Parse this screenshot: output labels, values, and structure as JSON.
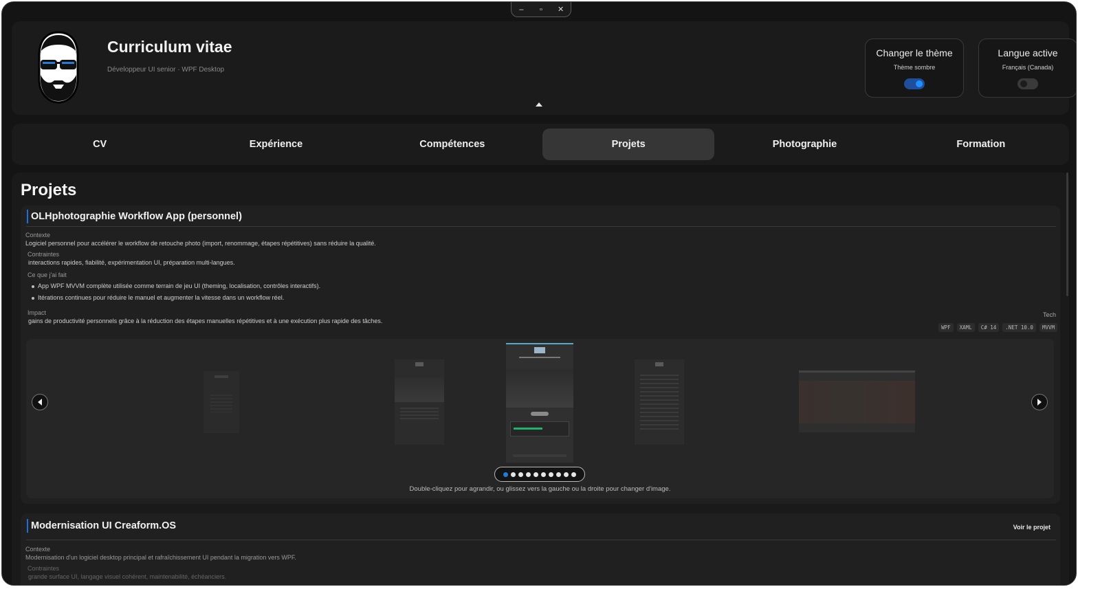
{
  "window": {
    "controls": {
      "minimize": "–",
      "maximize": "▫",
      "close": "✕"
    }
  },
  "header": {
    "title": "Curriculum vitae",
    "subtitle": "Développeur UI senior · WPF Desktop",
    "theme_card": {
      "title": "Changer le thème",
      "value": "Thème sombre",
      "toggle_on": true,
      "accent": "#1e90ff"
    },
    "language_card": {
      "title": "Langue active",
      "value": "Français (Canada)",
      "toggle_on": false
    }
  },
  "tabs": [
    {
      "label": "CV",
      "active": false
    },
    {
      "label": "Expérience",
      "active": false
    },
    {
      "label": "Compétences",
      "active": false
    },
    {
      "label": "Projets",
      "active": true
    },
    {
      "label": "Photographie",
      "active": false
    },
    {
      "label": "Formation",
      "active": false
    }
  ],
  "page": {
    "heading": "Projets",
    "projects": [
      {
        "title": "OLHphotographie Workflow App (personnel)",
        "context_label": "Contexte",
        "context": "Logiciel personnel pour accélérer le workflow de retouche photo (import, renommage, étapes répétitives) sans réduire la qualité.",
        "constraints_label": "Contraintes",
        "constraints": "interactions rapides, fiabilité, expérimentation UI, préparation multi-langues.",
        "done_label": "Ce que j'ai fait",
        "done": [
          "App WPF MVVM complète utilisée comme terrain de jeu UI (theming, localisation, contrôles interactifs).",
          "Itérations continues pour réduire le manuel et augmenter la vitesse dans un workflow réel."
        ],
        "impact_label": "Impact",
        "impact": "gains de productivité personnels grâce à la réduction des étapes manuelles répétitives et à une exécution plus rapide des tâches.",
        "tech_label": "Tech",
        "tech": [
          "WPF",
          "XAML",
          "C# 14",
          ".NET 10.0",
          "MVVM"
        ],
        "gallery": {
          "dot_count": 10,
          "active_index": 0,
          "hint": "Double-cliquez pour agrandir, ou glissez vers la gauche ou la droite pour changer d'image."
        }
      },
      {
        "title": "Modernisation UI Creaform.OS",
        "link": "Voir le projet",
        "context_label": "Contexte",
        "context": "Modernisation d'un logiciel desktop principal et rafraîchissement UI pendant la migration vers WPF.",
        "constraints_label": "Contraintes",
        "constraints": "grande surface UI, langage visuel cohérent, maintenabilité, échéanciers."
      }
    ]
  }
}
